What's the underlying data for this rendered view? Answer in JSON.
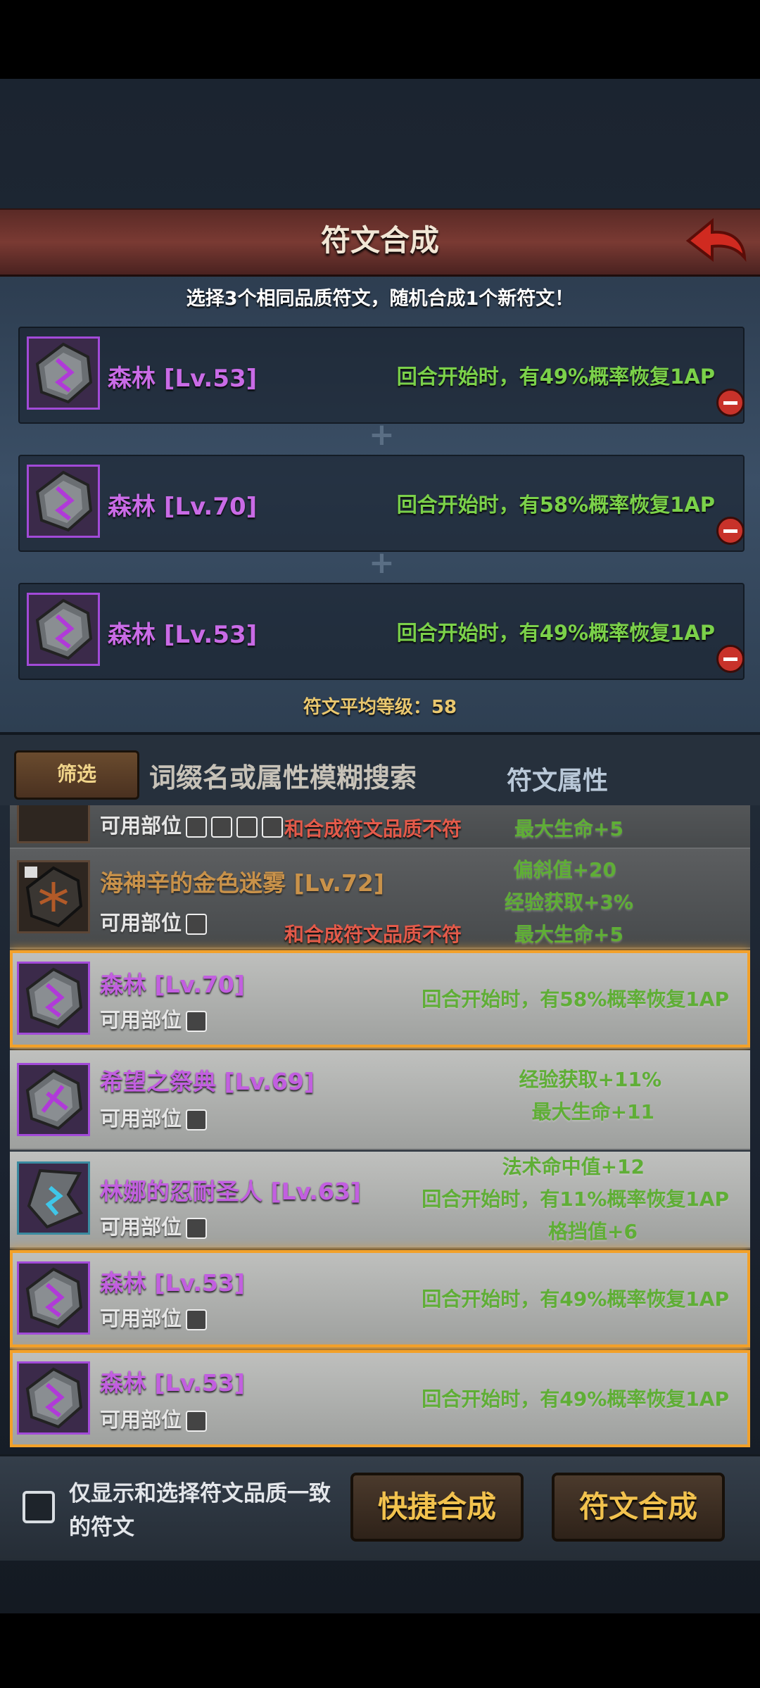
{
  "header": {
    "title": "符文合成",
    "back_icon": "back-arrow-icon"
  },
  "subtitle": "选择3个相同品质符文，随机合成1个新符文！",
  "selected_slots": [
    {
      "name": "森林 [Lv.53]",
      "effect": "回合开始时，有49%概率恢复1AP"
    },
    {
      "name": "森林 [Lv.70]",
      "effect": "回合开始时，有58%概率恢复1AP"
    },
    {
      "name": "森林 [Lv.53]",
      "effect": "回合开始时，有49%概率恢复1AP"
    }
  ],
  "plus": "+",
  "average_level": "符文平均等级：58",
  "filter": {
    "filter_label": "筛选",
    "search_placeholder": "词缀名或属性模糊搜索",
    "attr_tab": "符文属性"
  },
  "rune_list": [
    {
      "name": "",
      "slots_label": "可用部位",
      "warning": "和合成符文品质不符",
      "effects": [
        "最大生命+5"
      ],
      "state": "disabled"
    },
    {
      "name": "海神辛的金色迷雾 [Lv.72]",
      "slots_label": "可用部位",
      "warning": "和合成符文品质不符",
      "effects": [
        "偏斜值+20",
        "经验获取+3%",
        "最大生命+5"
      ],
      "state": "disabled"
    },
    {
      "name": "森林 [Lv.70]",
      "slots_label": "可用部位",
      "effects": [
        "回合开始时，有58%概率恢复1AP"
      ],
      "state": "selected"
    },
    {
      "name": "希望之祭典 [Lv.69]",
      "slots_label": "可用部位",
      "effects": [
        "经验获取+11%",
        "最大生命+11"
      ],
      "state": "normal"
    },
    {
      "name": "林娜的忍耐圣人 [Lv.63]",
      "slots_label": "可用部位",
      "effects": [
        "法术命中值+12",
        "回合开始时，有11%概率恢复1AP",
        "格挡值+6"
      ],
      "state": "normal"
    },
    {
      "name": "森林 [Lv.53]",
      "slots_label": "可用部位",
      "effects": [
        "回合开始时，有49%概率恢复1AP"
      ],
      "state": "selected"
    },
    {
      "name": "森林 [Lv.53]",
      "slots_label": "可用部位",
      "effects": [
        "回合开始时，有49%概率恢复1AP"
      ],
      "state": "selected"
    }
  ],
  "bottom": {
    "checkbox_label": "仅显示和选择符文品质一致的符文",
    "quick_button": "快捷合成",
    "compose_button": "符文合成"
  },
  "colors": {
    "accent_orange": "#f2a12a",
    "purple": "#c25fe0",
    "green": "#7bd14a",
    "warning_red": "#e35a4a"
  }
}
